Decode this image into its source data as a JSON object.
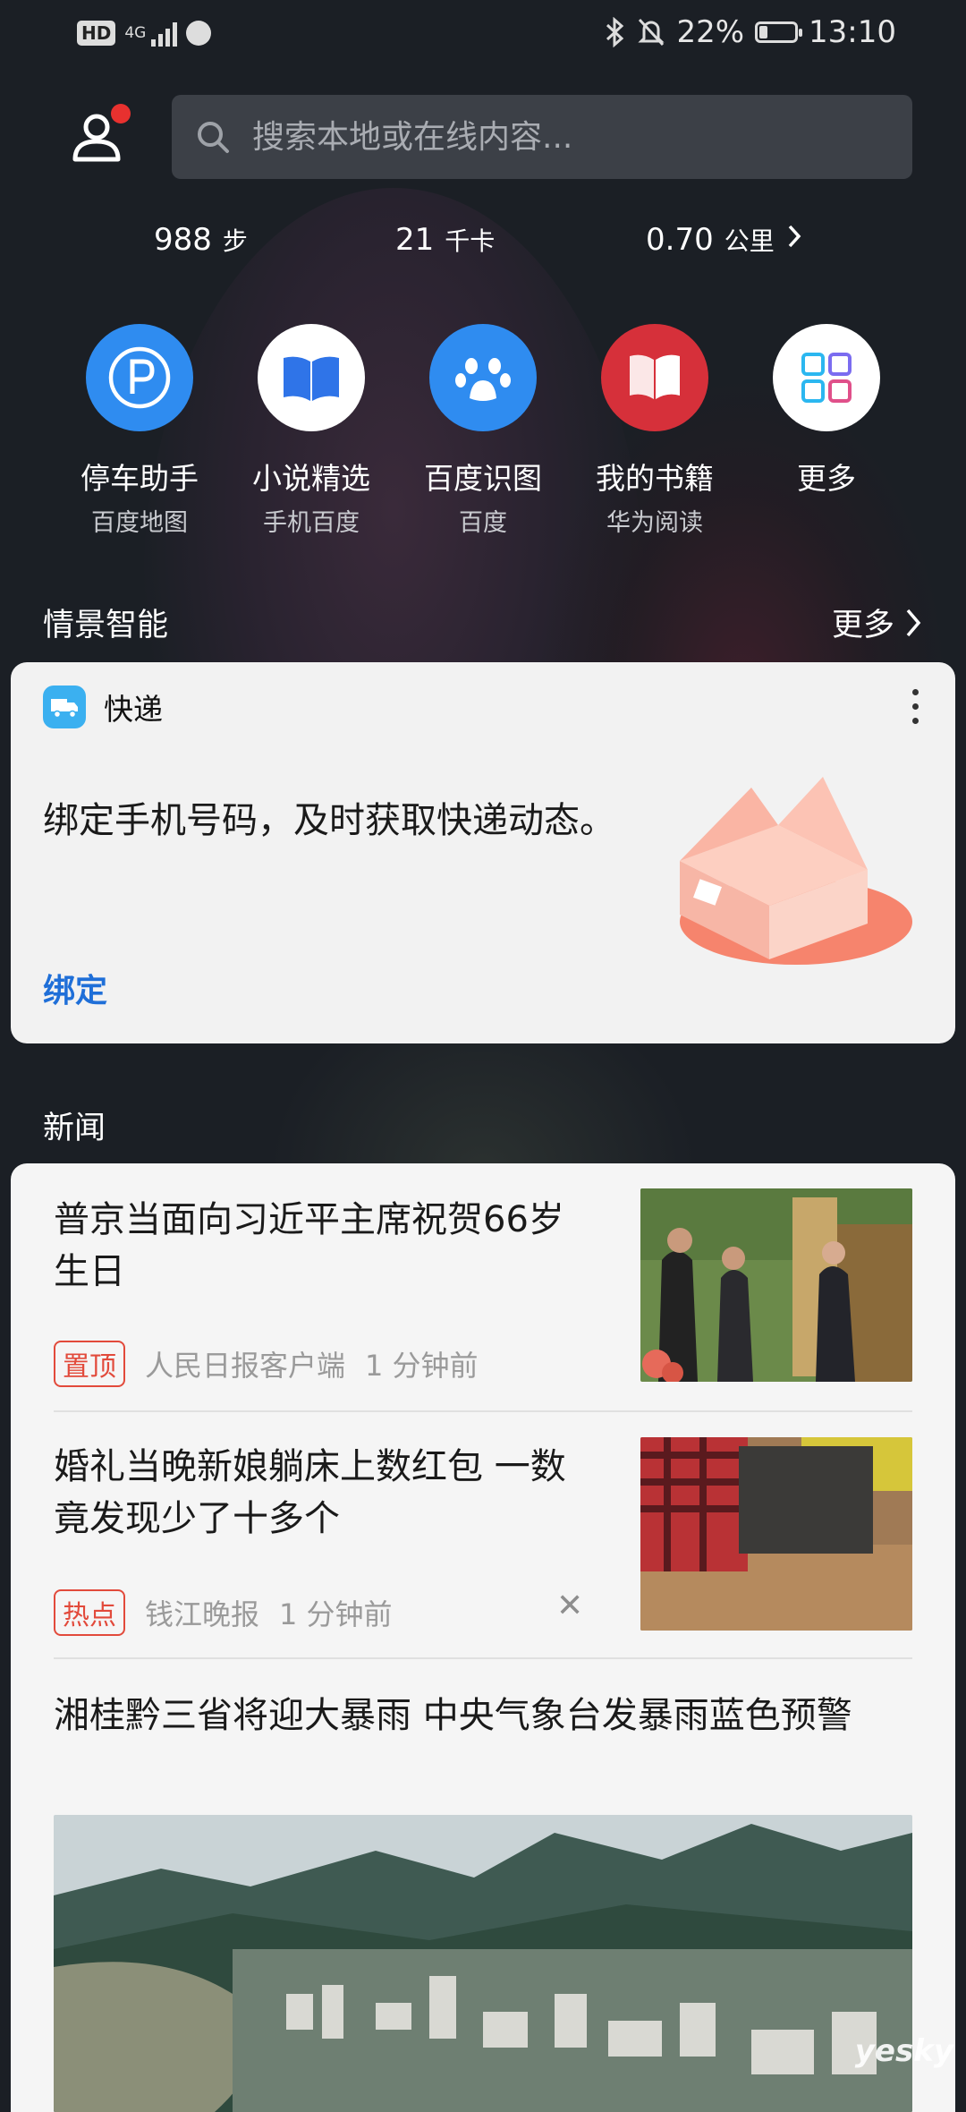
{
  "status_bar": {
    "hd": "HD",
    "network": "4G",
    "battery_percent": "22%",
    "battery_level": 0.22,
    "time": "13:10"
  },
  "search": {
    "placeholder": "搜索本地或在线内容..."
  },
  "stats": {
    "steps": {
      "value": "988",
      "unit": "步"
    },
    "calories": {
      "value": "21",
      "unit": "千卡"
    },
    "distance": {
      "value": "0.70",
      "unit": "公里"
    }
  },
  "apps": [
    {
      "name": "停车助手",
      "source": "百度地图",
      "icon": "parking-icon",
      "color": "#2f8cf0"
    },
    {
      "name": "小说精选",
      "source": "手机百度",
      "icon": "book-open-icon",
      "color": "#ffffff"
    },
    {
      "name": "百度识图",
      "source": "百度",
      "icon": "paw-icon",
      "color": "#2f8cf0"
    },
    {
      "name": "我的书籍",
      "source": "华为阅读",
      "icon": "reader-book-icon",
      "color": "#d6303a"
    },
    {
      "name": "更多",
      "source": "",
      "icon": "grid-icon",
      "color": "#ffffff"
    }
  ],
  "context": {
    "title": "情景智能",
    "more": "更多",
    "card": {
      "title": "快递",
      "message": "绑定手机号码，及时获取快递动态。",
      "action": "绑定"
    }
  },
  "news": {
    "title": "新闻",
    "items": [
      {
        "headline": "普京当面向习近平主席祝贺66岁生日",
        "tag": "置顶",
        "source": "人民日报客户端",
        "time": "1 分钟前"
      },
      {
        "headline": "婚礼当晚新娘躺床上数红包 一数竟发现少了十多个",
        "tag": "热点",
        "source": "钱江晚报",
        "time": "1 分钟前"
      },
      {
        "headline": "湘桂黔三省将迎大暴雨 中央气象台发暴雨蓝色预警"
      }
    ]
  },
  "watermark": "yesky"
}
